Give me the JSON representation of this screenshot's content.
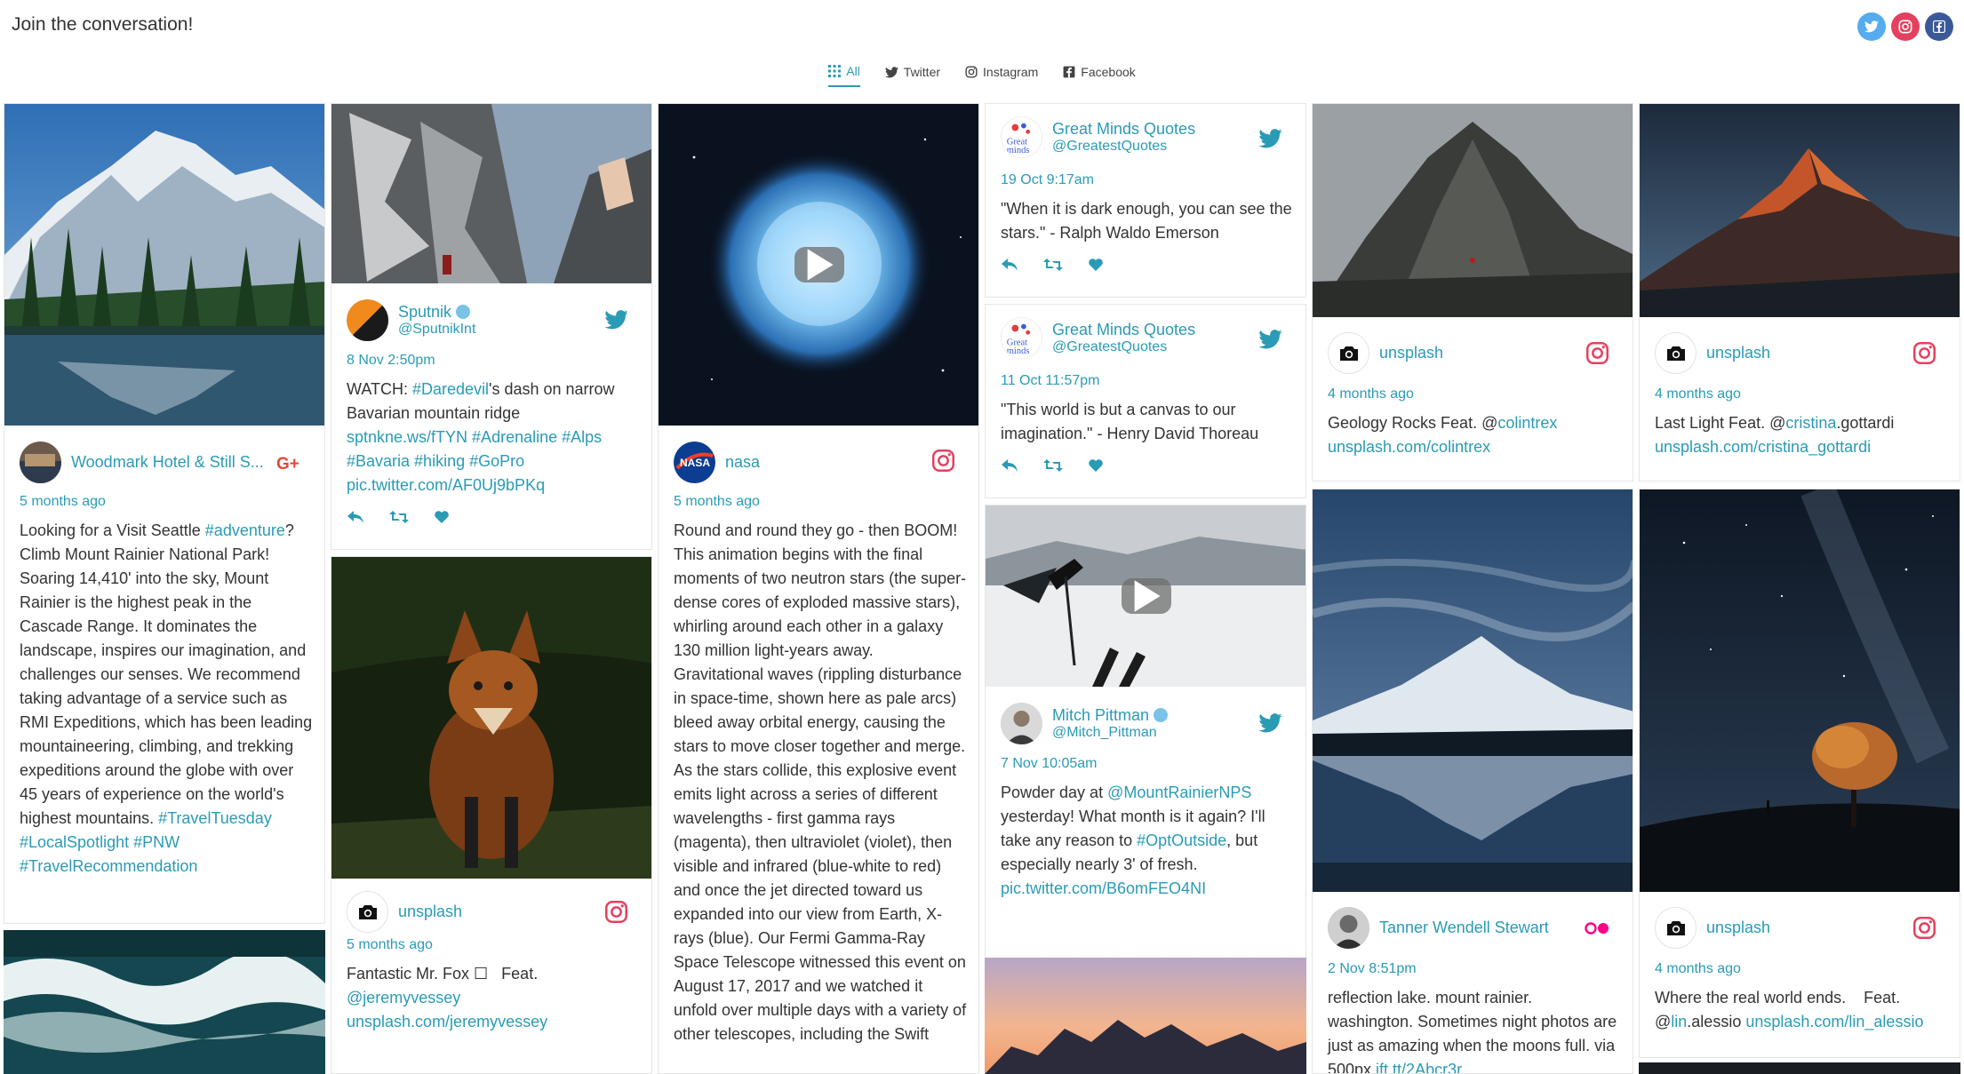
{
  "header": {
    "title": "Join the conversation!",
    "social_icons": [
      "twitter-icon",
      "instagram-icon",
      "facebook-icon"
    ]
  },
  "filters": {
    "all": "All",
    "twitter": "Twitter",
    "instagram": "Instagram",
    "facebook": "Facebook",
    "active": "all"
  },
  "colors": {
    "accent": "#2a9bb5",
    "twitter": "#55acee",
    "instagram": "#e4405f",
    "facebook": "#3b5998",
    "google_plus": "#dd4b39"
  },
  "posts": {
    "woodmark": {
      "author": "Woodmark Hotel & Still S...",
      "network": "google-plus",
      "time": "5 months ago",
      "text_parts": [
        "Looking for a Visit Seattle ",
        "#adventure",
        "? Climb Mount Rainier National Park! Soaring 14,410' into the sky, Mount Rainier is the highest peak in the Cascade Range. It dominates the landscape, inspires our imagination, and challenges our senses. We recommend taking advantage of a service such as RMI Expeditions, which has been leading mountaineering, climbing, and trekking expeditions around the globe with over 45 years of experience on the world's highest mountains. ",
        "#TravelTuesday #LocalSpotlight #PNW #TravelRecommendation"
      ]
    },
    "sputnik": {
      "author": "Sputnik",
      "handle": "@SputnikInt",
      "network": "twitter",
      "time": "8 Nov 2:50pm",
      "text_parts": [
        "WATCH: ",
        "#Daredevil",
        "'s dash on narrow Bavarian mountain ridge ",
        "sptnkne.ws/fTYN #Adrenaline #Alps #Bavaria #hiking #GoPro pic.twitter.com/AF0Uj9bPKq"
      ]
    },
    "unsplash_fox": {
      "author": "unsplash",
      "network": "instagram",
      "time": "5 months ago",
      "text_parts": [
        "Fantastic Mr. Fox ☐   Feat. ",
        "@jeremyvessey unsplash.com/jeremyvessey"
      ]
    },
    "nasa": {
      "author": "nasa",
      "network": "instagram",
      "time": "5 months ago",
      "text": "Round and round they go - then BOOM! This animation begins with the final moments of two neutron stars (the super-dense cores of exploded massive stars), whirling around each other in a galaxy 130 million light-years away. Gravitational waves (rippling disturbance in space-time, shown here as pale arcs) bleed away orbital energy, causing the stars to move closer together and merge. As the stars collide, this explosive event emits light across a series of different wavelengths - first gamma rays (magenta), then ultraviolet (violet), then visible and infrared (blue-white to red) and once the jet directed toward us expanded into our view from Earth, X-rays (blue). Our Fermi Gamma-Ray Space Telescope witnessed this event on August 17, 2017 and we watched it unfold over multiple days with a variety of other telescopes, including the Swift"
    },
    "gmq1": {
      "author": "Great Minds Quotes",
      "handle": "@GreatestQuotes",
      "network": "twitter",
      "time": "19 Oct 9:17am",
      "text": "\"When it is dark enough, you can see the stars.\" - Ralph Waldo Emerson"
    },
    "gmq2": {
      "author": "Great Minds Quotes",
      "handle": "@GreatestQuotes",
      "network": "twitter",
      "time": "11 Oct 11:57pm",
      "text": "\"This world is but a canvas to our imagination.\" - Henry David Thoreau"
    },
    "mitch": {
      "author": "Mitch Pittman",
      "handle": "@Mitch_Pittman",
      "network": "twitter",
      "time": "7 Nov 10:05am",
      "text_parts": [
        "Powder day at ",
        "@MountRainierNPS",
        " yesterday! What month is it again? I'll take any reason to ",
        "#OptOutside",
        ", but especially nearly 3' of fresh. ",
        "pic.twitter.com/B6omFEO4NI"
      ]
    },
    "unsplash_geology": {
      "author": "unsplash",
      "network": "instagram",
      "time": "4 months ago",
      "text_parts": [
        "Geology Rocks Feat. @",
        "colintrex unsplash.com/colintrex"
      ]
    },
    "unsplash_lastlight": {
      "author": "unsplash",
      "network": "instagram",
      "time": "4 months ago",
      "text_parts": [
        "Last Light Feat. @",
        "cristina",
        ".gottardi ",
        "unsplash.com/cristina_gottardi"
      ]
    },
    "tanner": {
      "author": "Tanner Wendell Stewart",
      "network": "flickr",
      "time": "2 Nov 8:51pm",
      "text_parts": [
        "reflection lake. mount rainier. washington. Sometimes night photos are just as amazing when the moons full. via 500px ",
        "ift.tt/2Abcr3r"
      ]
    },
    "unsplash_world": {
      "author": "unsplash",
      "network": "instagram",
      "time": "4 months ago",
      "text_parts": [
        "Where the real world ends.    Feat. @",
        "lin",
        ".alessio ",
        "unsplash.com/lin_alessio"
      ]
    }
  }
}
